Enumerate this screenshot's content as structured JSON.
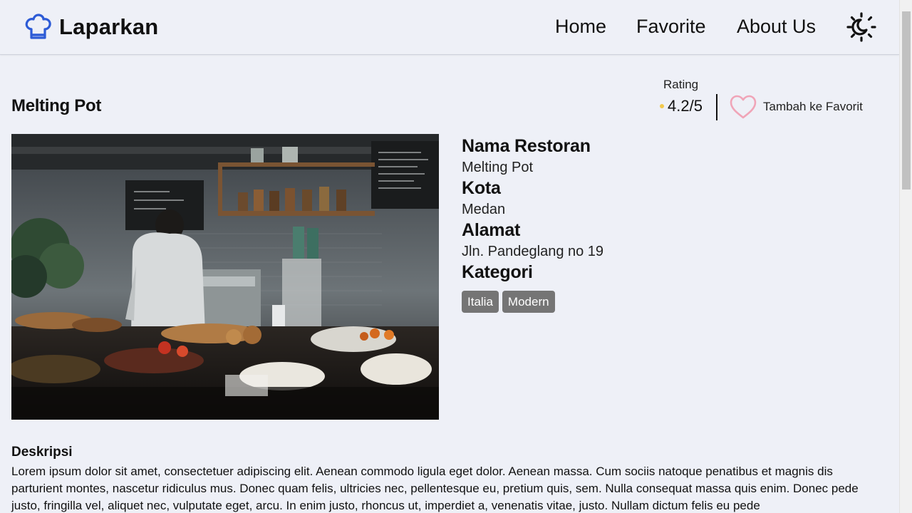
{
  "header": {
    "brand": "Laparkan",
    "nav": [
      {
        "label": "Home"
      },
      {
        "label": "Favorite"
      },
      {
        "label": "About Us"
      }
    ]
  },
  "restaurant": {
    "title": "Melting Pot",
    "rating_label": "Rating",
    "rating_value": "4.2/5",
    "favorite_label": "Tambah ke Favorit",
    "details": [
      {
        "heading": "Nama Restoran",
        "value": "Melting Pot"
      },
      {
        "heading": "Kota",
        "value": "Medan"
      },
      {
        "heading": "Alamat",
        "value": "Jln. Pandeglang no 19"
      }
    ],
    "category_heading": "Kategori",
    "categories": [
      "Italia",
      "Modern"
    ],
    "description_title": "Deskripsi",
    "description": "Lorem ipsum dolor sit amet, consectetuer adipiscing elit. Aenean commodo ligula eget dolor. Aenean massa. Cum sociis natoque penatibus et magnis dis parturient montes, nascetur ridiculus mus. Donec quam felis, ultricies nec, pellentesque eu, pretium quis, sem. Nulla consequat massa quis enim. Donec pede justo, fringilla vel, aliquet nec, vulputate eget, arcu. In enim justo, rhoncus ut, imperdiet a, venenatis vitae, justo. Nullam dictum felis eu pede"
  },
  "icons": {
    "logo": "chef-hat-icon",
    "theme": "sun-moon-icon",
    "favorite": "heart-outline-icon",
    "rating": "star-icon"
  },
  "colors": {
    "background": "#eef0f7",
    "brand_icon": "#2d5bd6",
    "heart": "#f0a5b8",
    "star": "#f2c94c",
    "tag_bg": "#757575"
  }
}
